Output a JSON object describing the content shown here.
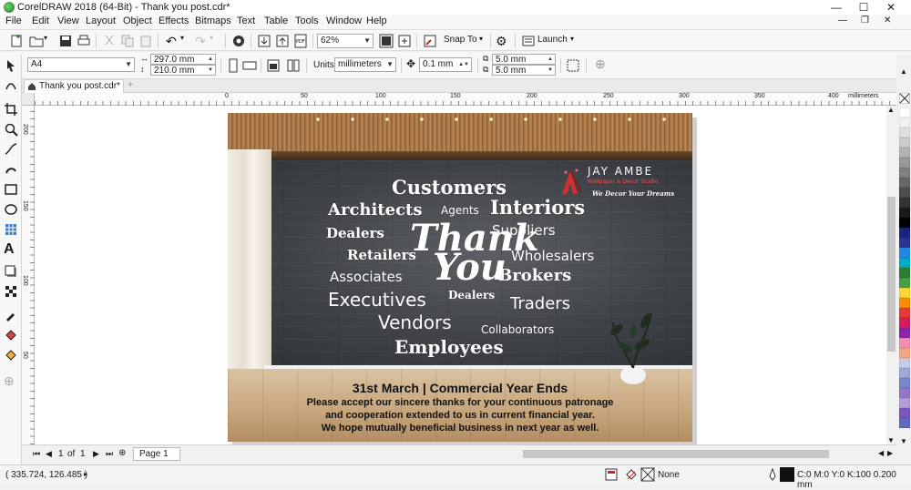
{
  "window": {
    "title": "CorelDRAW 2018 (64-Bit) - Thank you post.cdr*"
  },
  "menu": [
    "File",
    "Edit",
    "View",
    "Layout",
    "Object",
    "Effects",
    "Bitmaps",
    "Text",
    "Table",
    "Tools",
    "Window",
    "Help"
  ],
  "toolbar": {
    "zoom": "62%",
    "snap_label": "Snap To",
    "launch_label": "Launch"
  },
  "props": {
    "page_size": "A4",
    "width": "297.0 mm",
    "height": "210.0 mm",
    "units_label": "Units:",
    "units": "millimeters",
    "nudge": "0.1 mm",
    "dup_x": "5.0 mm",
    "dup_y": "5.0 mm"
  },
  "tab": {
    "label": "Thank you post.cdr*"
  },
  "ruler": {
    "h_ticks": [
      "0",
      "50",
      "100",
      "150",
      "200",
      "250",
      "300",
      "350",
      "400"
    ],
    "unit": "millimeters",
    "v_ticks": [
      "200",
      "150",
      "100",
      "50"
    ]
  },
  "poster": {
    "words": [
      "Customers",
      "Architects",
      "Agents",
      "Interiors",
      "Dealers",
      "Suppliers",
      "Retailers",
      "Wholesalers",
      "Associates",
      "Brokers",
      "Dealers",
      "Executives",
      "Traders",
      "Vendors",
      "Collaborators",
      "Employees"
    ],
    "thank": "Thank",
    "you": "You",
    "brand": {
      "name": "JAY AMBE",
      "subtitle": "Wallpaper & Decor Studio",
      "tagline": "We Decor Your Dreams"
    },
    "headline": "31st March | Commercial Year Ends",
    "lines": [
      "Please accept our sincere thanks for your continuous patronage",
      "and cooperation extended to us in current financial year.",
      "We hope mutually beneficial business in next year as well."
    ]
  },
  "pagenav": {
    "position": "1",
    "of": "of",
    "total": "1",
    "page_tab": "Page 1"
  },
  "status": {
    "coords": "( 335.724, 126.485 )",
    "fill": "None",
    "outline": "C:0 M:0 Y:0 K:100  0.200 mm"
  },
  "colors": {
    "palette": [
      "#ffffff",
      "#f2f2f2",
      "#e0e0e0",
      "#cccccc",
      "#b3b3b3",
      "#999999",
      "#808080",
      "#666666",
      "#4d4d4d",
      "#333333",
      "#1a1a1a",
      "#000000",
      "#1a237e",
      "#283593",
      "#1e88e5",
      "#00acc1",
      "#2e7d32",
      "#43a047",
      "#fdd835",
      "#fb8c00",
      "#e53935",
      "#d81b60",
      "#8e24aa",
      "#f48fb1",
      "#f4a582",
      "#c5cae9",
      "#9fa8da",
      "#7986cb",
      "#9575cd",
      "#b39ddb",
      "#7e57c2",
      "#5c6bc0"
    ]
  }
}
